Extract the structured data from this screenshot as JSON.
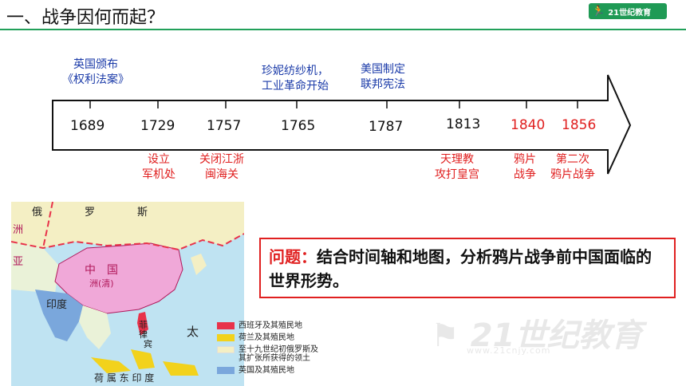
{
  "header": {
    "title": "一、战争因何而起？",
    "logo_text": "21世纪教育"
  },
  "timeline": {
    "years": [
      {
        "label": "1689",
        "color": "#111111"
      },
      {
        "label": "1729",
        "color": "#111111"
      },
      {
        "label": "1757",
        "color": "#111111"
      },
      {
        "label": "1765",
        "color": "#111111"
      },
      {
        "label": "1787",
        "color": "#111111"
      },
      {
        "label": "1813",
        "color": "#111111"
      },
      {
        "label": "1840",
        "color": "#e02020"
      },
      {
        "label": "1856",
        "color": "#e02020"
      }
    ],
    "top_notes": [
      {
        "line1": "英国颁布",
        "line2": "《权利法案》"
      },
      {
        "line1": "珍妮纺纱机，",
        "line2": "工业革命开始"
      },
      {
        "line1": "美国制定",
        "line2": "联邦宪法"
      }
    ],
    "bottom_notes": [
      {
        "line1": "设立",
        "line2": "军机处"
      },
      {
        "line1": "关闭江浙",
        "line2": "闽海关"
      },
      {
        "line1": "天理教",
        "line2": "攻打皇宫"
      },
      {
        "line1": "鸦片",
        "line2": "战争"
      },
      {
        "line1": "第二次",
        "line2": "鸦片战争"
      }
    ]
  },
  "map": {
    "labels": {
      "russia_e": "俄",
      "russia_luo": "罗",
      "russia_si": "斯",
      "asia_zhou": "洲",
      "asia_ya": "亚",
      "china": "中　国",
      "qing": "洲(清)",
      "india": "印度",
      "philippines_fei": "菲",
      "philippines_lv": "律",
      "philippines_bin": "宾",
      "taipingyang": "太",
      "dutch_indies": "荷 属 东 印 度"
    },
    "legend": [
      {
        "label": "西班牙及其殖民地",
        "color": "#e8324a"
      },
      {
        "label": "荷兰及其殖民地",
        "color": "#f2d21c"
      },
      {
        "label": "至十九世纪初俄罗斯及其扩张所获得的领土",
        "line1": "至十九世纪初俄罗斯及",
        "line2": "其扩张所获得的领土",
        "color": "#f4efc4"
      },
      {
        "label": "英国及其殖民地",
        "color": "#7aa7dc"
      }
    ]
  },
  "question": {
    "head": "问题：",
    "body": "结合时间轴和地图，分析鸦片战争前中国面临的世界形势。"
  },
  "colors": {
    "accent_green": "#22a05a",
    "red": "#e02020",
    "blue_text": "#1a3aa8"
  }
}
